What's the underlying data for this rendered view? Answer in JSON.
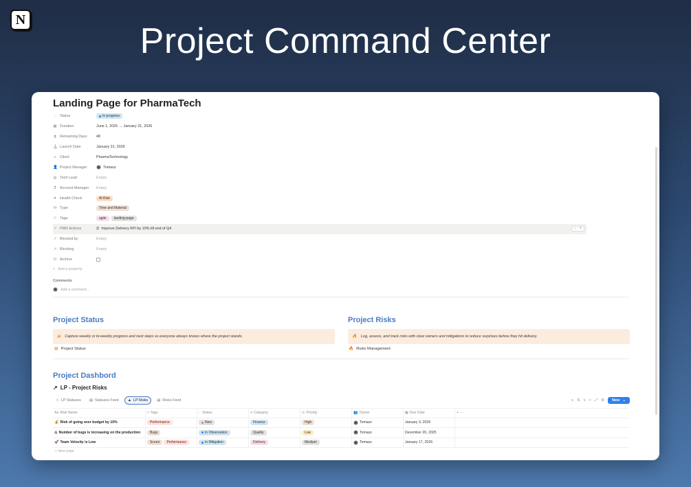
{
  "hero": {
    "title": "Project Command Center",
    "logo_letter": "N"
  },
  "page": {
    "title": "Landing Page for PharmaTech",
    "properties": [
      {
        "icon": "◌",
        "name": "Status",
        "type": "pills",
        "values": [
          {
            "text": "In progress",
            "color": "blue",
            "dot": "#2f80ed"
          }
        ]
      },
      {
        "icon": "▦",
        "name": "Duration",
        "type": "text",
        "value": "June 1, 2025 → January 31, 2026"
      },
      {
        "icon": "⧗",
        "name": "Remaining Days",
        "type": "text",
        "value": "48"
      },
      {
        "icon": "⚓",
        "name": "Launch Date",
        "type": "text",
        "value": "January 31, 2026"
      },
      {
        "icon": "≡",
        "name": "Client",
        "type": "text",
        "value": "PharmaTechnology"
      },
      {
        "icon": "👤",
        "name": "Project Manager",
        "type": "person",
        "value": "Tomasz"
      },
      {
        "icon": "◍",
        "name": "Tech Lead",
        "type": "empty",
        "value": "Empty"
      },
      {
        "icon": "❢",
        "name": "Account Manager",
        "type": "empty",
        "value": "Empty"
      },
      {
        "icon": "♥",
        "name": "Health Check",
        "type": "pills",
        "values": [
          {
            "text": "At Risk",
            "color": "orange"
          }
        ]
      },
      {
        "icon": "⛁",
        "name": "Type",
        "type": "pills",
        "values": [
          {
            "text": "Time and Material",
            "color": "brown"
          }
        ]
      },
      {
        "icon": "⌑",
        "name": "Tags",
        "type": "pills",
        "values": [
          {
            "text": "agile",
            "color": "pink"
          },
          {
            "text": "landing-page",
            "color": "gray"
          }
        ]
      },
      {
        "icon": "↗",
        "name": "PMO Actions",
        "type": "relation",
        "value": "Improve Delivery KPI by 10% till end of Q4",
        "controls": [
          "−",
          "+"
        ]
      },
      {
        "icon": "↗",
        "name": "Blocked by",
        "type": "empty",
        "value": "Empty"
      },
      {
        "icon": "↗",
        "name": "Blocking",
        "type": "empty",
        "value": "Empty"
      },
      {
        "icon": "☑",
        "name": "Archive",
        "type": "checkbox",
        "value": ""
      }
    ],
    "add_property": "Add a property",
    "comments_label": "Comments",
    "comment_placeholder": "Add a comment..."
  },
  "sections": {
    "status": {
      "heading": "Project Status",
      "callout": "Capture weekly or bi-weekly progress and next steps so everyone always knows where the project stands.",
      "link": "Project Status"
    },
    "risks": {
      "heading": "Project Risks",
      "callout": "Log, assess, and track risks with clear owners and mitigations to reduce surprises before they hit delivery.",
      "link": "Risks Management"
    }
  },
  "dashboard": {
    "heading": "Project Dashbord",
    "db_title": "LP - Project Risks",
    "views": [
      "LP Statuses",
      "Statuses Feed",
      "LP Risks",
      "Risks Feed"
    ],
    "active_view": "LP Risks",
    "new_button": "New",
    "columns": [
      "Risk Name",
      "Tags",
      "Status",
      "Category",
      "Priority",
      "Owner",
      "Due Date"
    ],
    "rows": [
      {
        "name": "Risk of going over budget by 10%",
        "tags": [
          {
            "text": "Performance",
            "color": "red"
          }
        ],
        "status": {
          "text": "New",
          "color": "gray"
        },
        "category": {
          "text": "Finance",
          "color": "blue"
        },
        "priority": {
          "text": "High",
          "color": "brown"
        },
        "owner": "Tomasz",
        "due": "January 3, 2026"
      },
      {
        "name": "Number of bugs is increasing on the production",
        "tags": [
          {
            "text": "Bugs",
            "color": "brown"
          }
        ],
        "status": {
          "text": "In Observation",
          "color": "blue"
        },
        "category": {
          "text": "Quality",
          "color": "gray"
        },
        "priority": {
          "text": "Low",
          "color": "yellow"
        },
        "owner": "Tomasz",
        "due": "December 20, 2025"
      },
      {
        "name": "Team Velocity is Low",
        "tags": [
          {
            "text": "Scrum",
            "color": "brown"
          },
          {
            "text": "Performance",
            "color": "red"
          }
        ],
        "status": {
          "text": "In Mitigation",
          "color": "blue"
        },
        "category": {
          "text": "Delivery",
          "color": "pink"
        },
        "priority": {
          "text": "Medium",
          "color": "gray"
        },
        "owner": "Tomasz",
        "due": "January 17, 2026"
      }
    ],
    "new_page": "New page"
  }
}
